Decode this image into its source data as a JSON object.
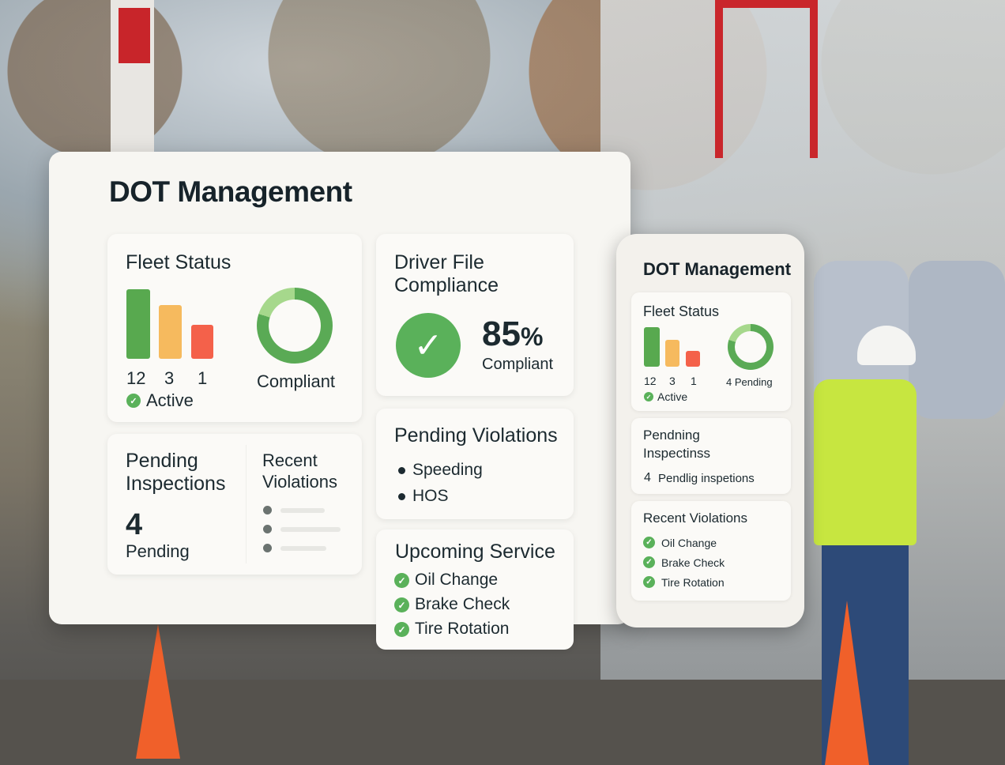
{
  "main": {
    "title": "DOT Management",
    "fleet_status": {
      "title": "Fleet Status",
      "counts": [
        "12",
        "3",
        "1"
      ],
      "active_label": "Active",
      "donut_label": "Compliant"
    },
    "driver_file": {
      "title_line1": "Driver File",
      "title_line2": "Compliance",
      "percent": "85",
      "percent_sign": "%",
      "label": "Compliant"
    },
    "pending_inspections": {
      "title_line1": "Pending",
      "title_line2": "Inspections",
      "count": "4",
      "label": "Pending"
    },
    "recent_violations": {
      "title_line1": "Recent",
      "title_line2": "Violations"
    },
    "pending_violations": {
      "title": "Pending Violations",
      "items": [
        "Speeding",
        "HOS"
      ]
    },
    "upcoming_service": {
      "title": "Upcoming Service",
      "items": [
        "Oil Change",
        "Brake Check",
        "Tire Rotation"
      ]
    }
  },
  "side": {
    "title": "DOT Management",
    "fleet_status": {
      "title": "Fleet Status",
      "counts": [
        "12",
        "3",
        "1"
      ],
      "active_label": "Active",
      "donut_label": "4 Pending"
    },
    "pending_inspections": {
      "title_line1": "Pendning",
      "title_line2": "Inspectinss",
      "count": "4",
      "label": "Pendlig inspetions"
    },
    "recent_violations": {
      "title": "Recent Violations",
      "items": [
        "Oil Change",
        "Brake Check",
        "Tire Rotation"
      ]
    }
  },
  "colors": {
    "accent_green": "#58a94f",
    "accent_orange": "#f6ba5e",
    "accent_red": "#f4614a"
  }
}
